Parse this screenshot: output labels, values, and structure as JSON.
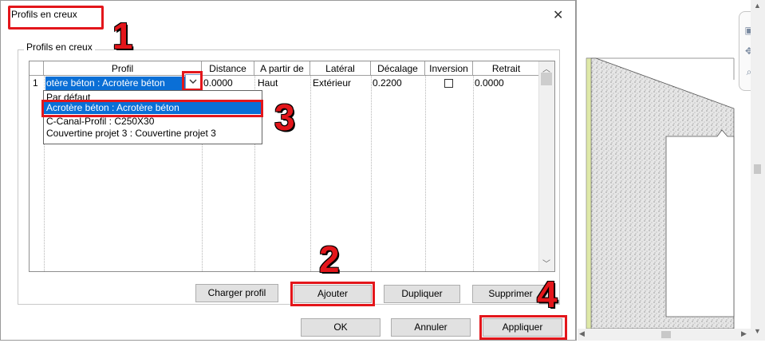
{
  "dialog": {
    "title": "Profils en creux",
    "close_glyph": "✕",
    "group_label": "Profils en creux"
  },
  "table": {
    "columns": [
      "Profil",
      "Distance",
      "A partir de",
      "Latéral",
      "Décalage",
      "Inversion",
      "Retrait"
    ],
    "rows": [
      {
        "num": "1",
        "profil": "otère béton : Acrotère béton",
        "distance": "0.0000",
        "a_partir_de": "Haut",
        "lateral": "Extérieur",
        "decalage": "0.2200",
        "inversion": false,
        "retrait": "0.0000"
      }
    ]
  },
  "dropdown": {
    "options": [
      "Par défaut",
      "Acrotère béton : Acrotère béton",
      "C-Canal-Profil : C250X30",
      "Couvertine projet 3 : Couvertine projet 3"
    ],
    "selected_index": 1
  },
  "buttons": {
    "charger": "Charger profil",
    "ajouter": "Ajouter",
    "dupliquer": "Dupliquer",
    "supprimer": "Supprimer",
    "ok": "OK",
    "annuler": "Annuler",
    "appliquer": "Appliquer"
  },
  "steps": [
    "1",
    "2",
    "3",
    "4"
  ],
  "icons": {
    "dropdown": "chevron-down-icon",
    "scroll_up": "chevron-up-icon",
    "scroll_down": "chevron-down-icon"
  },
  "colors": {
    "highlight": "#e3161b",
    "selection": "#0a6fd6",
    "concrete": "#e6e6e6",
    "finish_strip": "#dfe9a8"
  }
}
